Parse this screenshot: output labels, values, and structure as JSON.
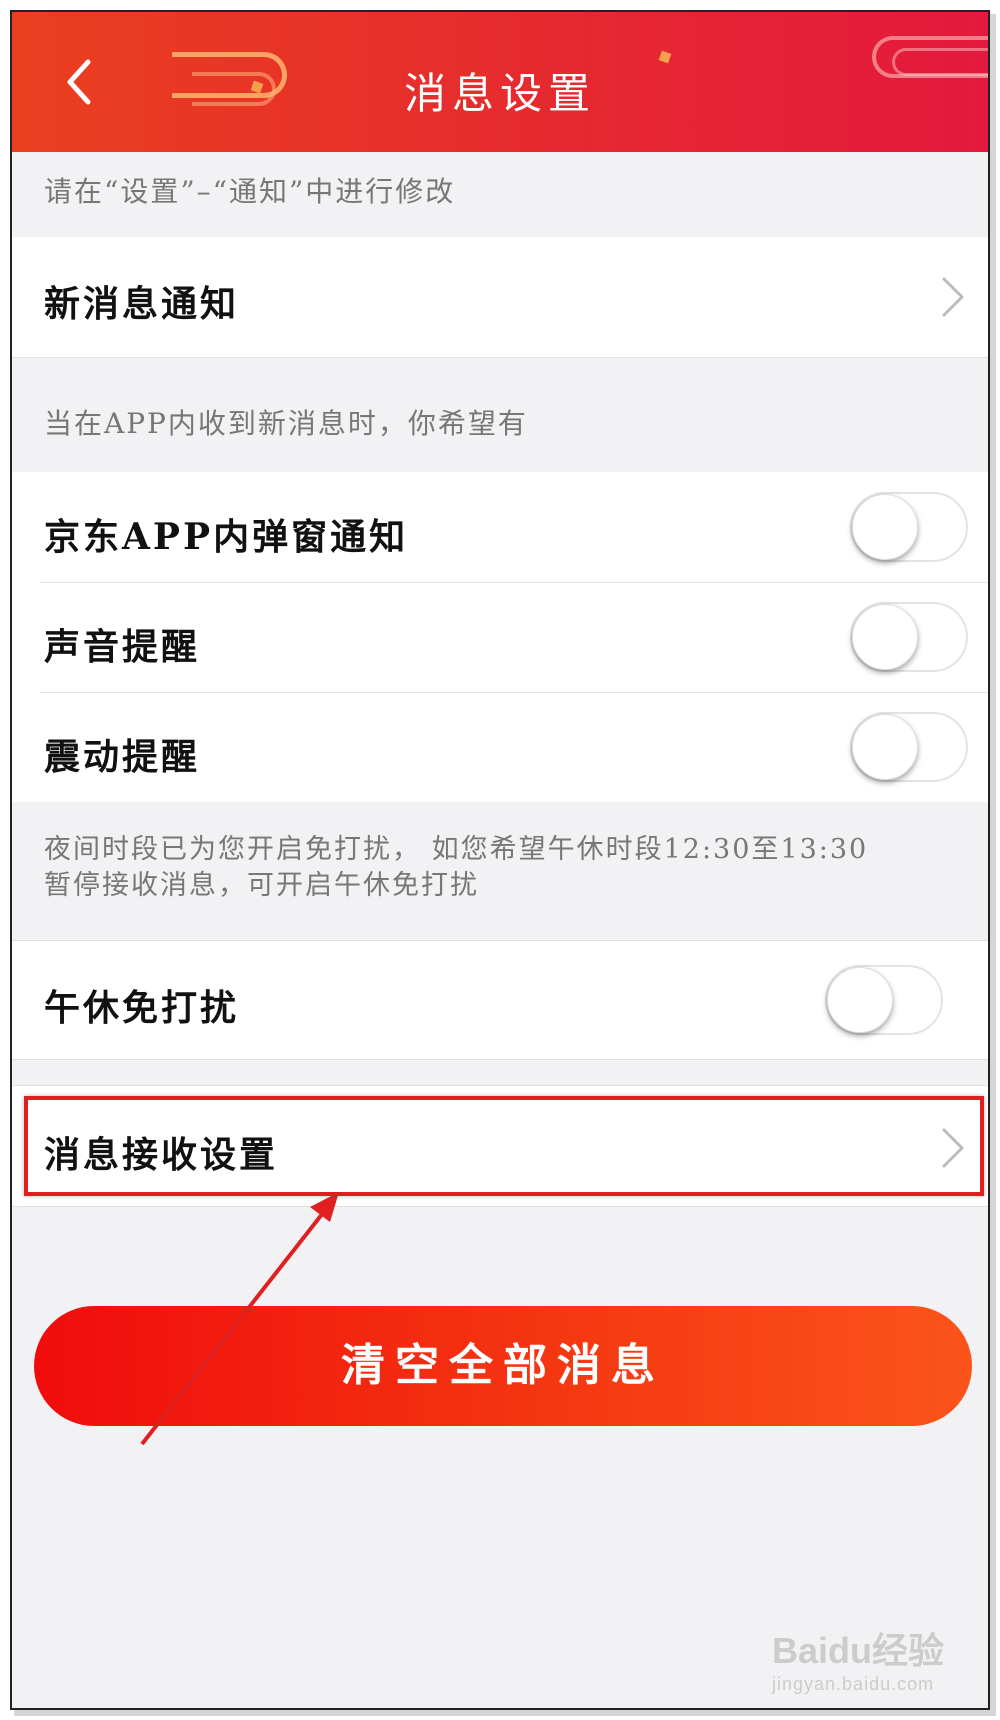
{
  "header": {
    "title": "消息设置",
    "back_icon": "chevron-left-icon"
  },
  "notice_hint": "请在“设置”–“通知”中进行修改",
  "new_message_notice": {
    "label": "新消息通知"
  },
  "in_app_hint": "当在APP内收到新消息时，你希望有",
  "toggles": [
    {
      "label": "京东APP内弹窗通知",
      "on": false
    },
    {
      "label": "声音提醒",
      "on": false
    },
    {
      "label": "震动提醒",
      "on": false
    }
  ],
  "dnd_hint": {
    "line1": "夜间时段已为您开启免打扰， 如您希望午休时段12:30至13:30",
    "line2": "暂停接收消息，可开启午休免打扰"
  },
  "noon_dnd": {
    "label": "午休免打扰",
    "on": false
  },
  "receive_settings": {
    "label": "消息接收设置"
  },
  "clear_button": {
    "label": "清空全部消息"
  },
  "watermark": {
    "main": "Baidu经验",
    "sub": "jingyan.baidu.com"
  },
  "colors": {
    "header_start": "#ea3f1f",
    "header_end": "#e4193e",
    "button_start": "#f00c0c",
    "button_end": "#fb541a",
    "highlight": "#e02020"
  }
}
